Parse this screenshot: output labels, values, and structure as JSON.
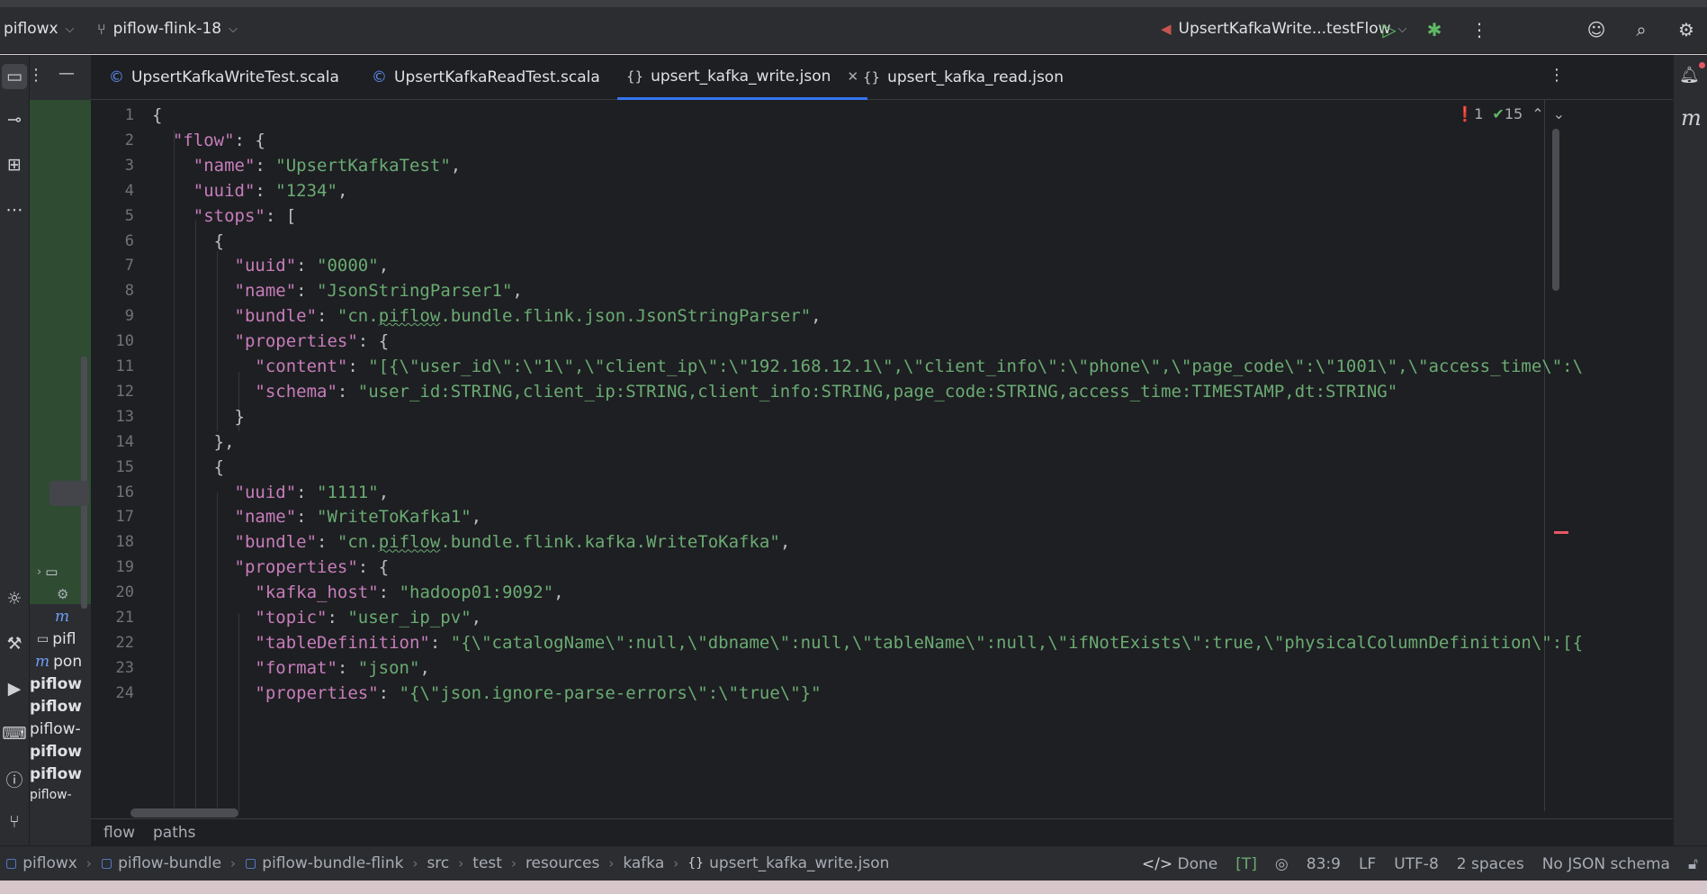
{
  "titlebar": {
    "project": "piflowx",
    "branch": "piflow-flink-18",
    "run_config": "UpsertKafkaWrite...testFlow"
  },
  "tabs": [
    {
      "label": "UpsertKafkaWriteTest.scala",
      "type": "scala",
      "active": false
    },
    {
      "label": "UpsertKafkaReadTest.scala",
      "type": "scala",
      "active": false
    },
    {
      "label": "upsert_kafka_write.json",
      "type": "json",
      "active": true
    },
    {
      "label": "upsert_kafka_read.json",
      "type": "json",
      "active": false
    }
  ],
  "inspection": {
    "errors": "1",
    "ok": "15"
  },
  "project_panel": {
    "items": [
      "pifl",
      "pon",
      "piflow",
      "piflow",
      "piflow-",
      "piflow",
      "piflow",
      "piflow-"
    ]
  },
  "code_lines": [
    "{",
    "  \"flow\": {",
    "    \"name\": \"UpsertKafkaTest\",",
    "    \"uuid\": \"1234\",",
    "    \"stops\": [",
    "      {",
    "        \"uuid\": \"0000\",",
    "        \"name\": \"JsonStringParser1\",",
    "        \"bundle\": \"cn.piflow.bundle.flink.json.JsonStringParser\",",
    "        \"properties\": {",
    "          \"content\": \"[{\\\"user_id\\\":\\\"1\\\",\\\"client_ip\\\":\\\"192.168.12.1\\\",\\\"client_info\\\":\\\"phone\\\",\\\"page_code\\\":\\\"1001\\\",\\\"access_time\\\":\\\"",
    "          \"schema\": \"user_id:STRING,client_ip:STRING,client_info:STRING,page_code:STRING,access_time:TIMESTAMP,dt:STRING\"",
    "        }",
    "      },",
    "      {",
    "        \"uuid\": \"1111\",",
    "        \"name\": \"WriteToKafka1\",",
    "        \"bundle\": \"cn.piflow.bundle.flink.kafka.WriteToKafka\",",
    "        \"properties\": {",
    "          \"kafka_host\": \"hadoop01:9092\",",
    "          \"topic\": \"user_ip_pv\",",
    "          \"tableDefinition\": \"{\\\"catalogName\\\":null,\\\"dbname\\\":null,\\\"tableName\\\":null,\\\"ifNotExists\\\":true,\\\"physicalColumnDefinition\\\":[{\\",
    "          \"format\": \"json\",",
    "          \"properties\": \"{\\\"json.ignore-parse-errors\\\":\\\"true\\\"}\""
  ],
  "line_numbers": [
    "1",
    "2",
    "3",
    "4",
    "5",
    "6",
    "7",
    "8",
    "9",
    "10",
    "11",
    "12",
    "13",
    "14",
    "15",
    "16",
    "17",
    "18",
    "19",
    "20",
    "21",
    "22",
    "23",
    "24"
  ],
  "editor_breadcrumb": [
    "flow",
    "paths"
  ],
  "status": {
    "path": [
      "piflowx",
      "piflow-bundle",
      "piflow-bundle-flink",
      "src",
      "test",
      "resources",
      "kafka",
      "upsert_kafka_write.json"
    ],
    "done": "Done",
    "position": "83:9",
    "line_sep": "LF",
    "encoding": "UTF-8",
    "indent": "2 spaces",
    "schema": "No JSON schema"
  }
}
